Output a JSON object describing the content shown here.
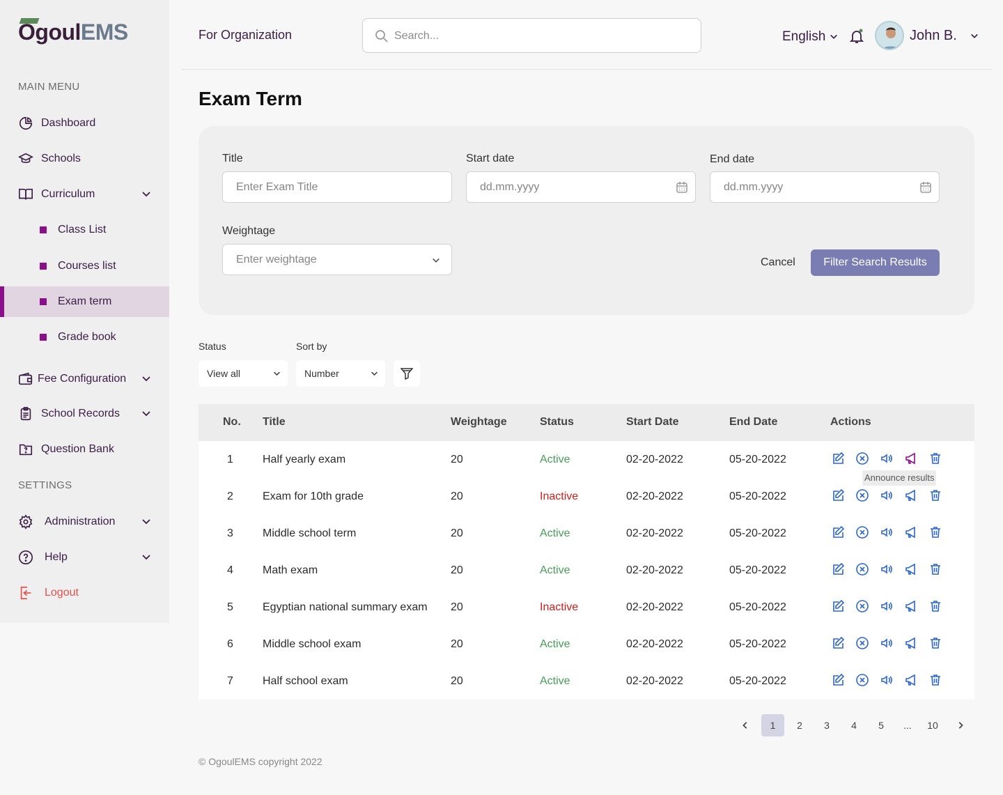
{
  "brand": {
    "logo_part1": "Ogoul",
    "logo_part2": "EMS"
  },
  "sidebar": {
    "main_menu_title": "MAIN MENU",
    "settings_title": "SETTINGS",
    "items": {
      "dashboard": "Dashboard",
      "schools": "Schools",
      "curriculum": "Curriculum",
      "class_list": "Class List",
      "courses_list": "Courses list",
      "exam_term": "Exam term",
      "grade_book": "Grade book",
      "fee_configuration": "Fee Configuration",
      "school_records": "School Records",
      "question_bank": "Question Bank",
      "administration": "Administration",
      "help": "Help",
      "logout": "Logout"
    }
  },
  "header": {
    "org_label": "For Organization",
    "search_placeholder": "Search...",
    "language": "English",
    "username": "John B."
  },
  "page": {
    "title": "Exam Term"
  },
  "filters": {
    "title_label": "Title",
    "title_placeholder": "Enter Exam Title",
    "start_label": "Start date",
    "start_placeholder": "dd.mm.yyyy",
    "end_label": "End date",
    "end_placeholder": "dd.mm.yyyy",
    "weightage_label": "Weightage",
    "weightage_placeholder": "Enter weightage",
    "cancel": "Cancel",
    "submit": "Filter Search Results"
  },
  "list_controls": {
    "status_label": "Status",
    "status_value": "View all",
    "sort_label": "Sort by",
    "sort_value": "Number"
  },
  "table": {
    "headers": {
      "no": "No.",
      "title": "Title",
      "weightage": "Weightage",
      "status": "Status",
      "start": "Start Date",
      "end": "End Date",
      "actions": "Actions"
    },
    "rows": [
      {
        "no": "1",
        "title": "Half yearly exam",
        "weightage": "20",
        "status": "Active",
        "start": "02-20-2022",
        "end": "05-20-2022"
      },
      {
        "no": "2",
        "title": "Exam for 10th grade",
        "weightage": "20",
        "status": "Inactive",
        "start": "02-20-2022",
        "end": "05-20-2022"
      },
      {
        "no": "3",
        "title": "Middle school term",
        "weightage": "20",
        "status": "Active",
        "start": "02-20-2022",
        "end": "05-20-2022"
      },
      {
        "no": "4",
        "title": "Math exam",
        "weightage": "20",
        "status": "Active",
        "start": "02-20-2022",
        "end": "05-20-2022"
      },
      {
        "no": "5",
        "title": "Egyptian national summary exam",
        "weightage": "20",
        "status": "Inactive",
        "start": "02-20-2022",
        "end": "05-20-2022"
      },
      {
        "no": "6",
        "title": "Middle school exam",
        "weightage": "20",
        "status": "Active",
        "start": "02-20-2022",
        "end": "05-20-2022"
      },
      {
        "no": "7",
        "title": "Half school exam",
        "weightage": "20",
        "status": "Active",
        "start": "02-20-2022",
        "end": "05-20-2022"
      }
    ],
    "tooltip": "Announce results"
  },
  "pagination": {
    "pages": [
      "1",
      "2",
      "3",
      "4",
      "5",
      "...",
      "10"
    ],
    "current": "1"
  },
  "footer": {
    "copyright": "© OgoulEMS copyright 2022"
  },
  "colors": {
    "brand_purple": "#3b1d46",
    "accent_magenta": "#8b0e8b",
    "button_violet": "#7a7db2",
    "active_green": "#4a9a5a",
    "inactive_red": "#c81e1e",
    "action_blue": "#2f66c7"
  }
}
